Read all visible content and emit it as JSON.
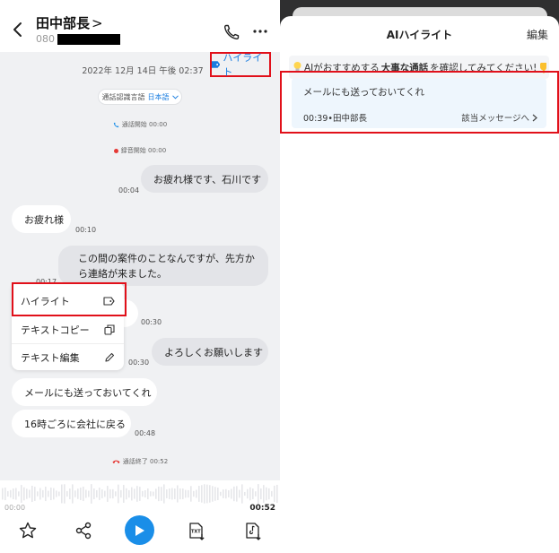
{
  "left": {
    "header": {
      "contact_name": "田中部長",
      "name_chevron": ">",
      "phone_prefix": "080"
    },
    "highlight_button_label": "ハイライト",
    "date_line": "2022年 12月 14日 午後 02:37",
    "lang": {
      "label": "通話認識言語",
      "value": "日本語"
    },
    "call_start": "通話開始 00:00",
    "rec_start": "録音開始 00:00",
    "messages": [
      {
        "text": "お疲れ様です、石川です",
        "time": "00:04"
      },
      {
        "text": "お疲れ様",
        "time": "00:10"
      },
      {
        "text": "この間の案件のことなんですが、先方から連絡が来ました。",
        "time": "00:17"
      },
      {
        "text": "",
        "time": "00:30"
      },
      {
        "text": "よろしくお願いします",
        "time": "00:30"
      },
      {
        "text": "メールにも送っておいてくれ",
        "time": ""
      },
      {
        "text": "16時ごろに会社に戻る",
        "time": "00:48"
      }
    ],
    "context_menu": {
      "highlight": "ハイライト",
      "copy": "テキストコピー",
      "edit": "テキスト編集"
    },
    "call_end": "通話終了 00:52",
    "player": {
      "start_time": "00:00",
      "end_time": "00:52",
      "txt_label": "TXT"
    }
  },
  "right": {
    "title": "AIハイライト",
    "edit_label": "編集",
    "banner": {
      "pre": "AIがおすすめする",
      "bold": "大事な通話",
      "post": "を確認してみてください!"
    },
    "highlight_card": {
      "text": "メールにも送っておいてくれ",
      "meta": "00:39•田中部長",
      "link": "該当メッセージへ"
    }
  },
  "colors": {
    "accent_blue": "#1a8ee8",
    "highlight_red": "#e1101a",
    "bubble_gray": "#e3e4e8",
    "chat_bg": "#f0f1f3"
  }
}
